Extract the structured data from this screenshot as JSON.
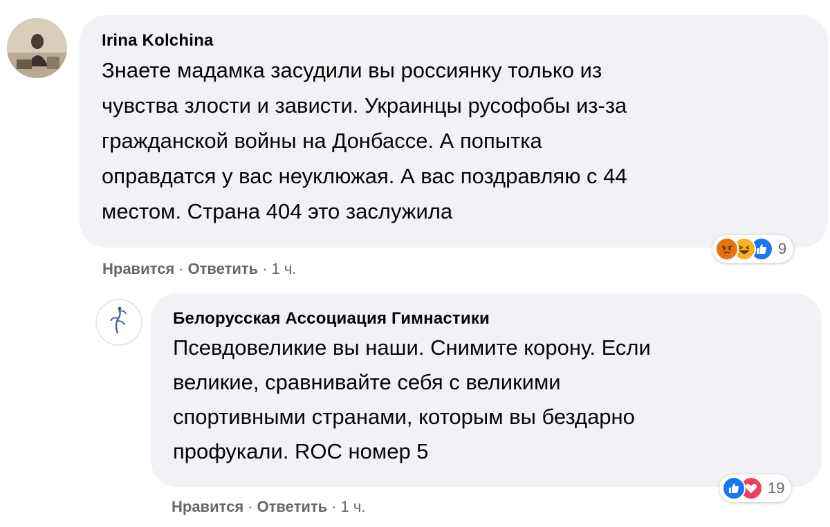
{
  "comments": [
    {
      "author": "Irina Kolchina",
      "lines": [
        "Знаете мадамка засудили вы россиянку только из",
        "чувства злости и зависти. Украинцы русофобы из-за",
        "гражданской войны на Донбассе. А попытка",
        "оправдатся у вас неуклюжая. А вас поздравляю с 44",
        "местом. Страна 404 это заслужила"
      ],
      "actions": {
        "like": "Нравится",
        "reply": "Ответить",
        "time": "1 ч."
      },
      "reactions": {
        "icons": [
          "angry-icon",
          "haha-icon",
          "like-icon"
        ],
        "count": "9"
      }
    },
    {
      "author": "Белорусская Ассоциация Гимнастики",
      "lines": [
        "Псевдовеликие вы наши. Снимите корону. Если",
        "великие, сравнивайте себя с великими",
        "спортивными странами, которым вы бездарно",
        "профукали. ROC номер 5"
      ],
      "actions": {
        "like": "Нравится",
        "reply": "Ответить",
        "time": "1 ч."
      },
      "reactions": {
        "icons": [
          "like-icon",
          "love-icon"
        ],
        "count": "19"
      }
    }
  ],
  "colors": {
    "bubble": "#f0f2f5",
    "meta_text": "#65676b",
    "like": "#1877f2",
    "love": "#f33e58",
    "angry": "#e9710f",
    "haha": "#f7b125"
  }
}
